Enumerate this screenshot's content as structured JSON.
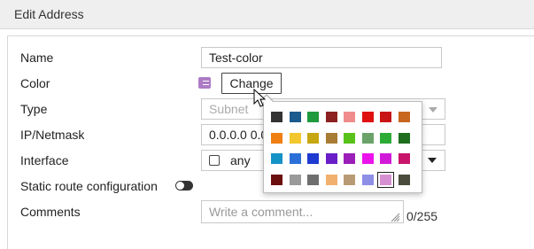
{
  "dialog": {
    "title": "Edit Address"
  },
  "form": {
    "name_label": "Name",
    "name_value": "Test-color",
    "color_label": "Color",
    "change_label": "Change",
    "type_label": "Type",
    "type_value": "Subnet",
    "ip_label": "IP/Netmask",
    "ip_value": "0.0.0.0 0.0",
    "interface_label": "Interface",
    "interface_value": "any",
    "static_route_label": "Static route configuration",
    "static_route_enabled": false,
    "comments_label": "Comments",
    "comments_placeholder": "Write a comment...",
    "comments_counter": "0/255"
  },
  "palette": {
    "selected_index": 30,
    "colors": [
      "#333333",
      "#1a5a8c",
      "#1f9a3e",
      "#8d2121",
      "#f08c8c",
      "#e01010",
      "#c81414",
      "#c8661e",
      "#ee7f10",
      "#f3c72e",
      "#c6a611",
      "#a87c34",
      "#58c21a",
      "#6aa26a",
      "#2cab35",
      "#1e6e1e",
      "#1592c6",
      "#2d6fd8",
      "#1e3ad0",
      "#6a1ec8",
      "#9b1eb9",
      "#ec12ec",
      "#d11ad8",
      "#c8156a",
      "#6b0e0e",
      "#9a9a9a",
      "#6e6e6e",
      "#f2b06e",
      "#b89b74",
      "#8e8ee6",
      "#d68fd3",
      "#4c4c3c"
    ]
  }
}
